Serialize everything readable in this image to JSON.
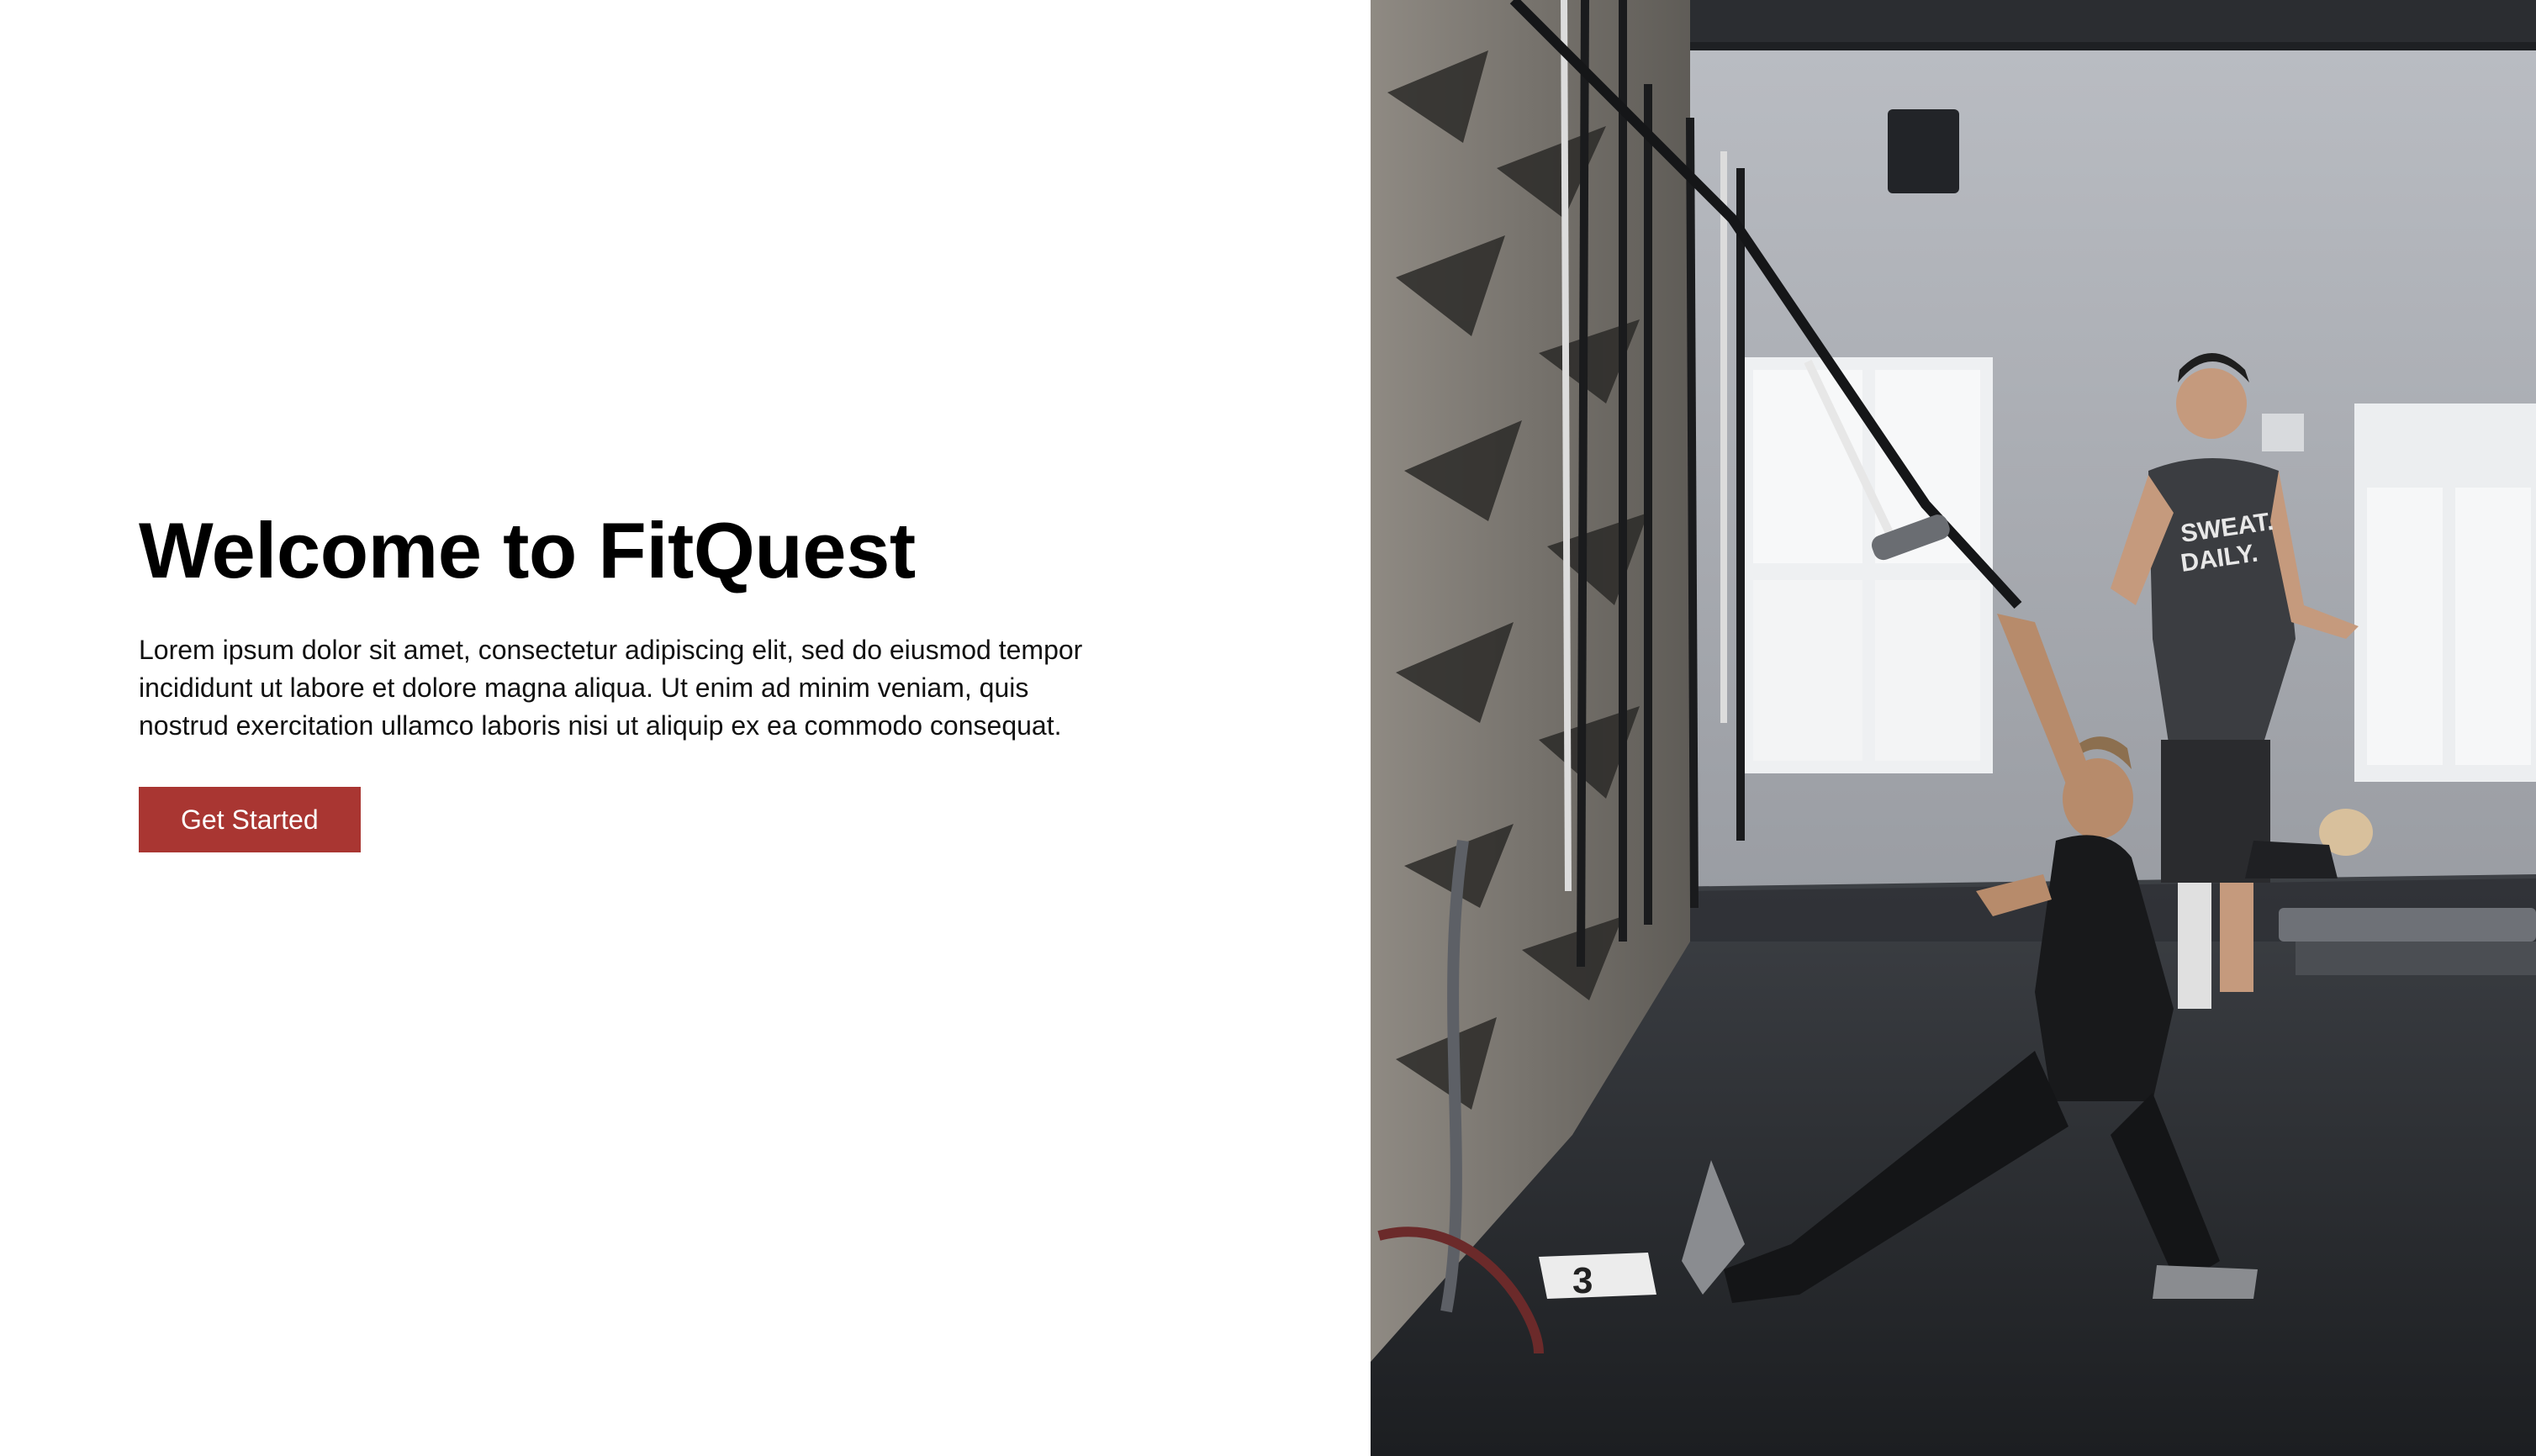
{
  "hero": {
    "title": "Welcome to FitQuest",
    "description": "Lorem ipsum dolor sit amet, consectetur adipiscing elit, sed do eiusmod tempor incididunt ut labore et dolore magna aliqua. Ut enim ad minim veniam, quis nostrud exercitation ullamco laboris nisi ut aliquip ex ea commodo consequat.",
    "cta_label": "Get Started",
    "cta_color": "#a93632"
  },
  "photo": {
    "shirt_line1": "SWEAT.",
    "shirt_line2": "DAILY.",
    "floor_marker": "3"
  }
}
